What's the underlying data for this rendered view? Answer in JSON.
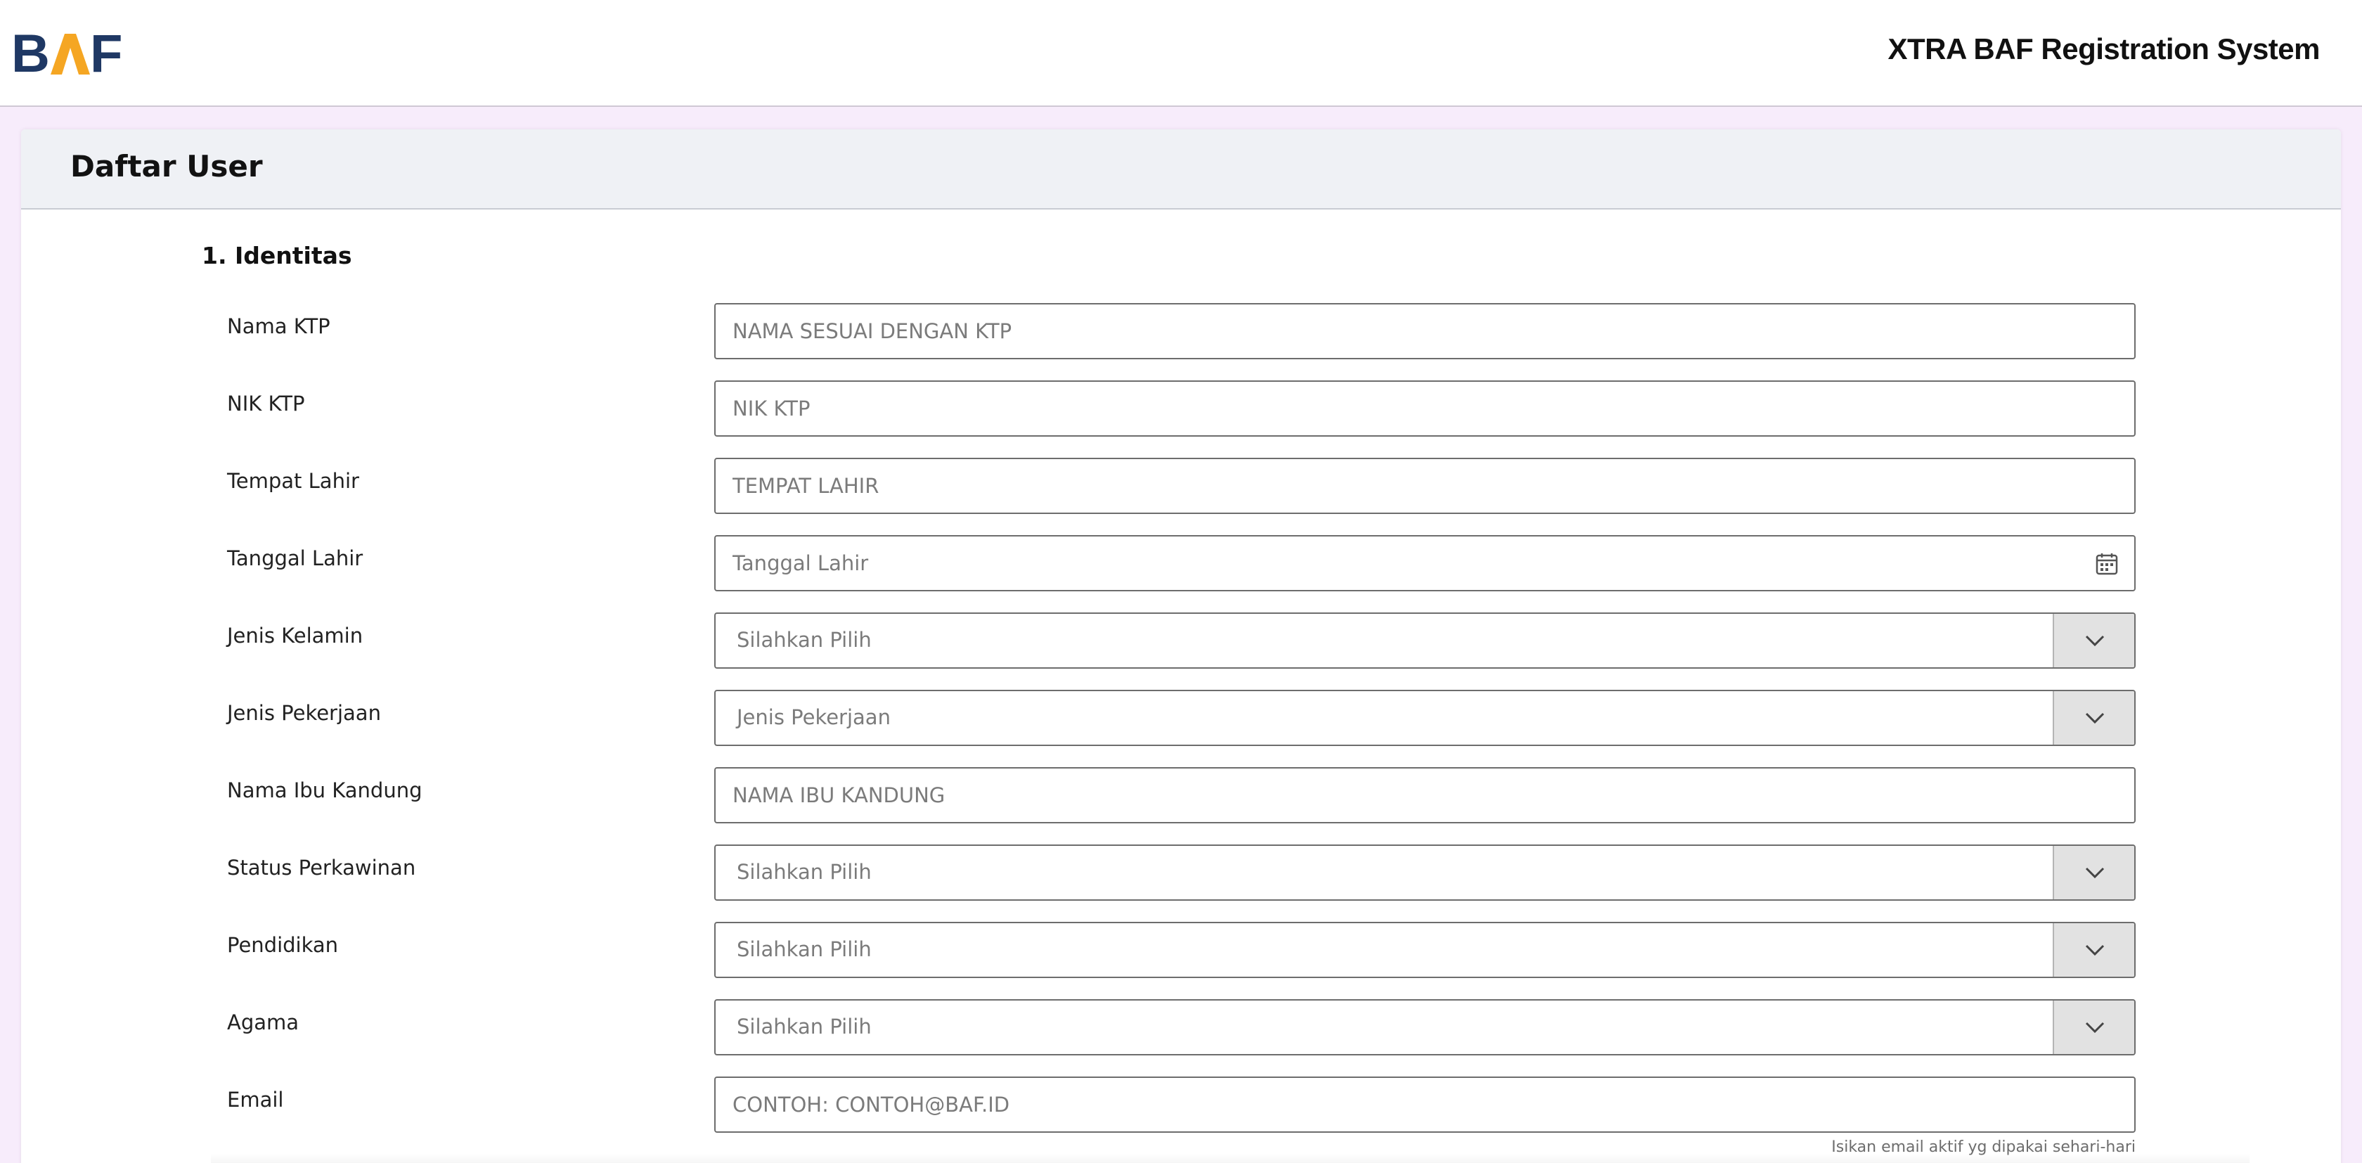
{
  "brand": {
    "logo_text": "BAF",
    "colors": {
      "navy": "#1f3864",
      "orange": "#f5a623"
    }
  },
  "header": {
    "app_title": "XTRA BAF Registration System"
  },
  "card": {
    "title": "Daftar User"
  },
  "section": {
    "title": "1. Identitas"
  },
  "fields": {
    "nama_ktp": {
      "label": "Nama KTP",
      "placeholder": "NAMA SESUAI DENGAN KTP"
    },
    "nik_ktp": {
      "label": "NIK KTP",
      "placeholder": "NIK KTP"
    },
    "tempat_lahir": {
      "label": "Tempat Lahir",
      "placeholder": "TEMPAT LAHIR"
    },
    "tanggal_lahir": {
      "label": "Tanggal Lahir",
      "placeholder": "Tanggal Lahir",
      "icon": "calendar-icon"
    },
    "jenis_kelamin": {
      "label": "Jenis Kelamin",
      "selected": "Silahkan Pilih"
    },
    "jenis_pekerjaan": {
      "label": "Jenis Pekerjaan",
      "selected": "Jenis Pekerjaan"
    },
    "nama_ibu": {
      "label": "Nama Ibu Kandung",
      "placeholder": "NAMA IBU KANDUNG"
    },
    "status_perkawinan": {
      "label": "Status Perkawinan",
      "selected": "Silahkan Pilih"
    },
    "pendidikan": {
      "label": "Pendidikan",
      "selected": "Silahkan Pilih"
    },
    "agama": {
      "label": "Agama",
      "selected": "Silahkan Pilih"
    },
    "email": {
      "label": "Email",
      "placeholder": "CONTOH: CONTOH@BAF.ID",
      "hint": "Isikan email aktif yg dipakai sehari-hari"
    }
  }
}
